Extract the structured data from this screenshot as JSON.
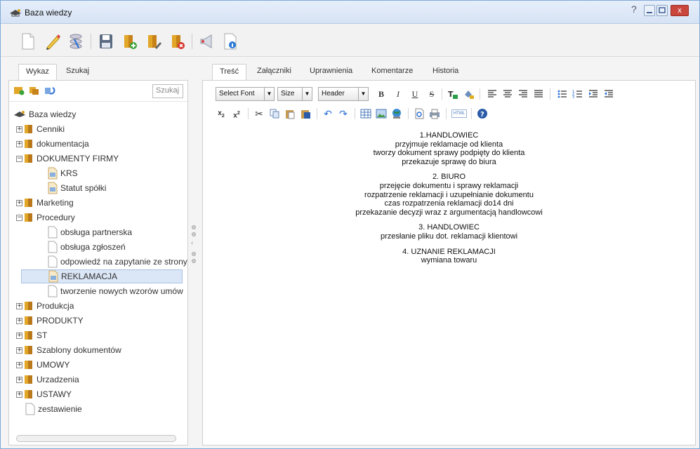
{
  "window": {
    "title": "Baza wiedzy",
    "help": "?",
    "close": "x"
  },
  "left": {
    "tabs": [
      "Wykaz",
      "Szukaj"
    ],
    "search_label": "Szukaj",
    "root": "Baza wiedzy",
    "items": [
      {
        "label": "Cenniki",
        "type": "folder",
        "expand": "+",
        "level": 1
      },
      {
        "label": "dokumentacja",
        "type": "folder",
        "expand": "+",
        "level": 1
      },
      {
        "label": "DOKUMENTY FIRMY",
        "type": "folder",
        "expand": "−",
        "level": 1
      },
      {
        "label": "KRS",
        "type": "doc-img",
        "level": 2
      },
      {
        "label": "Statut spółki",
        "type": "doc-img",
        "level": 2
      },
      {
        "label": "Marketing",
        "type": "folder",
        "expand": "+",
        "level": 1
      },
      {
        "label": "Procedury",
        "type": "folder",
        "expand": "−",
        "level": 1
      },
      {
        "label": "obsługa partnerska",
        "type": "doc",
        "level": 2
      },
      {
        "label": "obsługa zgłoszeń",
        "type": "doc",
        "level": 2
      },
      {
        "label": "odpowiedź na zapytanie ze strony",
        "type": "doc",
        "level": 2
      },
      {
        "label": "REKLAMACJA",
        "type": "doc-img",
        "level": 2,
        "selected": true
      },
      {
        "label": "tworzenie nowych wzorów umów",
        "type": "doc",
        "level": 2
      },
      {
        "label": "Produkcja",
        "type": "folder",
        "expand": "+",
        "level": 1
      },
      {
        "label": "PRODUKTY",
        "type": "folder",
        "expand": "+",
        "level": 1
      },
      {
        "label": "ST",
        "type": "folder",
        "expand": "+",
        "level": 1
      },
      {
        "label": "Szablony dokumentów",
        "type": "folder",
        "expand": "+",
        "level": 1
      },
      {
        "label": "UMOWY",
        "type": "folder",
        "expand": "+",
        "level": 1
      },
      {
        "label": "Urzadzenia",
        "type": "folder",
        "expand": "+",
        "level": 1
      },
      {
        "label": "USTAWY",
        "type": "folder",
        "expand": "+",
        "level": 1
      },
      {
        "label": "zestawienie",
        "type": "doc",
        "level": 1
      }
    ]
  },
  "right": {
    "tabs": [
      "Treść",
      "Załączniki",
      "Uprawnienia",
      "Komentarze",
      "Historia"
    ],
    "editor": {
      "font": "Select Font",
      "size": "Size",
      "format": "Header",
      "bold": "B",
      "italic": "I",
      "underline": "U",
      "strike": "S",
      "html": "HTML"
    },
    "content": [
      [
        "1.HANDLOWIEC",
        "przyjmuje reklamacje od klienta",
        "tworzy dokument sprawy podpięty do klienta",
        "przekazuje sprawę do biura"
      ],
      [
        "2. BIURO",
        "przejęcie dokumentu i sprawy reklamacji",
        "rozpatrzenie reklamacji i uzupełnianie dokumentu",
        "czas rozpatrzenia reklamacji  do14 dni",
        "przekazanie decyzji wraz z argumentacją handlowcowi"
      ],
      [
        "3. HANDLOWIEC",
        "przesłanie pliku dot. reklamacji klientowi"
      ],
      [
        "4. UZNANIE REKLAMACJI",
        "wymiana towaru"
      ]
    ]
  }
}
